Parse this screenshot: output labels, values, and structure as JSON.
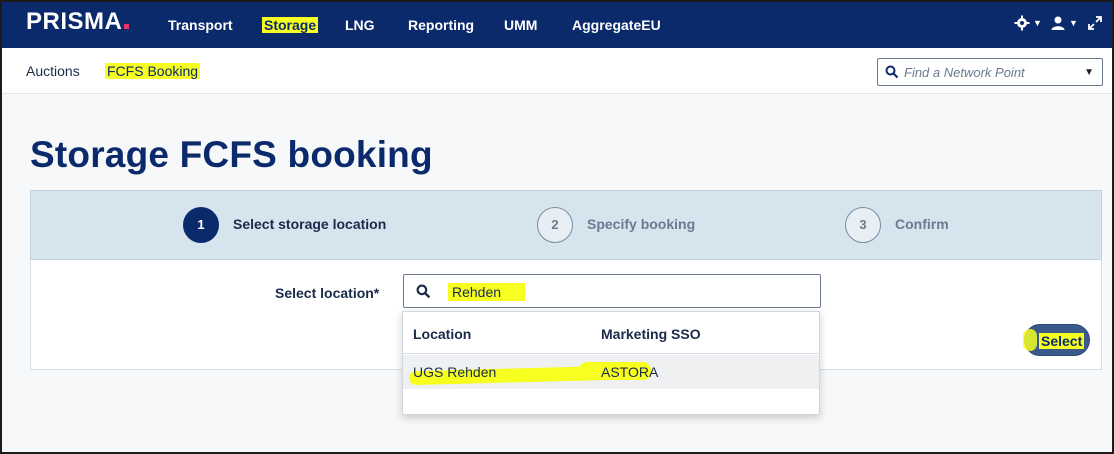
{
  "app": {
    "logo": "PRISMA"
  },
  "topnav": {
    "items": [
      "Transport",
      "Storage",
      "LNG",
      "Reporting",
      "UMM",
      "AggregateEU"
    ],
    "active": "Storage"
  },
  "subnav": {
    "items": [
      "Auctions",
      "FCFS Booking"
    ],
    "active": "FCFS Booking",
    "network_search_placeholder": "Find a Network Point"
  },
  "page": {
    "title": "Storage FCFS booking"
  },
  "stepper": {
    "steps": [
      {
        "number": "1",
        "label": "Select storage location",
        "state": "active"
      },
      {
        "number": "2",
        "label": "Specify booking",
        "state": "idle"
      },
      {
        "number": "3",
        "label": "Confirm",
        "state": "idle"
      }
    ]
  },
  "form": {
    "location_label": "Select location*",
    "location_value": "Rehden",
    "select_button": "Select"
  },
  "dropdown": {
    "headers": [
      "Location",
      "Marketing SSO"
    ],
    "rows": [
      {
        "location": "UGS Rehden",
        "sso": "ASTORA"
      }
    ]
  },
  "colors": {
    "navy": "#0b2a6b",
    "highlight": "#f6ff1f",
    "stepper_bg": "#d6e4ee",
    "brand_dot": "#e8336a"
  },
  "icons": {
    "settings": "gear-icon",
    "user": "user-icon",
    "expand": "expand-icon",
    "search": "search-icon",
    "dropdown": "chevron-down-icon"
  }
}
